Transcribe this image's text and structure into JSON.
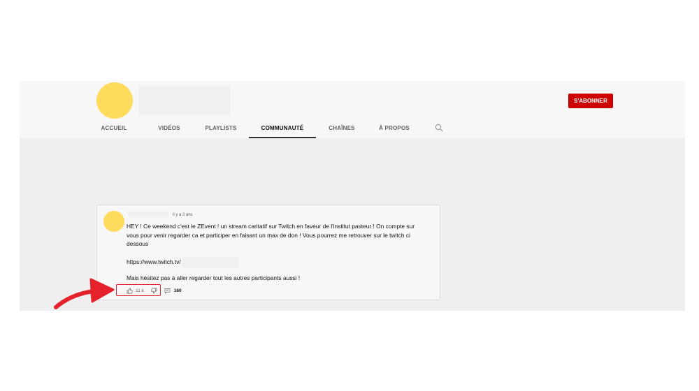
{
  "channel": {
    "subscribe_label": "S'ABONNER"
  },
  "tabs": [
    {
      "label": "ACCUEIL"
    },
    {
      "label": "VIDÉOS"
    },
    {
      "label": "PLAYLISTS"
    },
    {
      "label": "COMMUNAUTÉ",
      "active": true
    },
    {
      "label": "CHAÎNES"
    },
    {
      "label": "À PROPOS"
    }
  ],
  "post": {
    "time": "il y a 2 ans",
    "paragraph1": "HEY ! Ce weekend c'est le ZEvent ! un stream caritatif sur Twitch en faveur de l'institut pasteur ! On compte sur vous pour venir regarder ca et participer en faisant un max de don ! Vous pourrez me retrouver sur le twitch ci dessous",
    "link": "https://www.twitch.tv/",
    "paragraph2": "Mais hésitez pas à aller regarder tout les autres participants aussi !",
    "likes": "11 k",
    "comments": "160"
  },
  "colors": {
    "brand_red": "#cc0000",
    "avatar_yellow": "#ffdc5e",
    "annotation_red": "#e5222b"
  },
  "icons": [
    "search-icon",
    "like-icon",
    "dislike-icon",
    "comment-icon",
    "arrow-annotation"
  ]
}
